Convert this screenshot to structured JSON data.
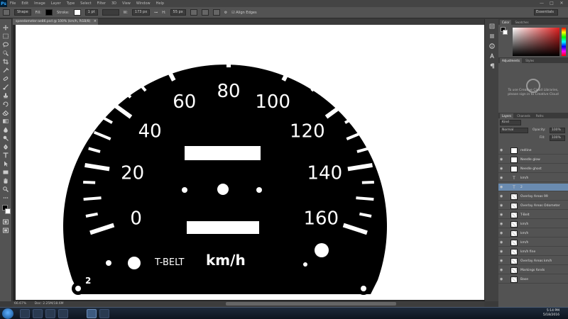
{
  "app": {
    "logo": "Ps",
    "menu": [
      "File",
      "Edit",
      "Image",
      "Layer",
      "Type",
      "Select",
      "Filter",
      "3D",
      "View",
      "Window",
      "Help"
    ],
    "window_controls": [
      "—",
      "□",
      "✕"
    ]
  },
  "options_bar": {
    "preset_label": "Shape",
    "fill_label": "Fill:",
    "stroke_label": "Stroke:",
    "stroke_width": "1 pt",
    "w_label": "W:",
    "w_value": "173 px",
    "h_label": "H:",
    "h_value": "55 px",
    "align_edges": "Align Edges",
    "workspace": "Essentials"
  },
  "document": {
    "tab_title": "speedometer-ae86.psd @ 100% (km/h, RGB/8)",
    "zoom": "66.67%",
    "doc_info": "Doc: 2.25M/18.6M"
  },
  "gauge": {
    "scale_labels": [
      "0",
      "20",
      "40",
      "60",
      "80",
      "100",
      "120",
      "140",
      "160"
    ],
    "unit_label": "km/h",
    "warning_label": "T-BELT",
    "corner_mark": "2"
  },
  "color_panel": {
    "tabs": [
      "Color",
      "Swatches"
    ]
  },
  "cc_panel": {
    "tabs": [
      "Adjustments",
      "Styles"
    ],
    "message": "To use Creative Cloud Libraries, please sign in to Creative Cloud"
  },
  "layers_panel": {
    "tabs": [
      "Layers",
      "Channels",
      "Paths"
    ],
    "kind_filter": "Kind",
    "blend_mode": "Normal",
    "opacity_label": "Opacity:",
    "opacity_value": "100%",
    "fill_label": "Fill:",
    "fill_value": "100%",
    "layers": [
      {
        "name": "redline",
        "kind": "shape",
        "selected": false
      },
      {
        "name": "Needle glow",
        "kind": "shape",
        "selected": false
      },
      {
        "name": "Needle ghost",
        "kind": "shape",
        "selected": false
      },
      {
        "name": "km/h",
        "kind": "text",
        "selected": false
      },
      {
        "name": "2",
        "kind": "text",
        "selected": true
      },
      {
        "name": "Overlay Areas 99",
        "kind": "pixel",
        "selected": false
      },
      {
        "name": "Overlay Areas Odometer",
        "kind": "pixel",
        "selected": false
      },
      {
        "name": "T-Belt",
        "kind": "pixel",
        "selected": false
      },
      {
        "name": "km/h",
        "kind": "pixel",
        "selected": false
      },
      {
        "name": "km/h",
        "kind": "pixel",
        "selected": false
      },
      {
        "name": "km/h",
        "kind": "pixel",
        "selected": false
      },
      {
        "name": "km/h fine",
        "kind": "pixel",
        "selected": false
      },
      {
        "name": "Overlay Areas km/h",
        "kind": "pixel",
        "selected": false
      },
      {
        "name": "Markings fonds",
        "kind": "pixel",
        "selected": false
      },
      {
        "name": "Base",
        "kind": "pixel",
        "selected": false
      }
    ]
  },
  "taskbar": {
    "time": "5:14 PM",
    "date": "5/18/2016"
  }
}
